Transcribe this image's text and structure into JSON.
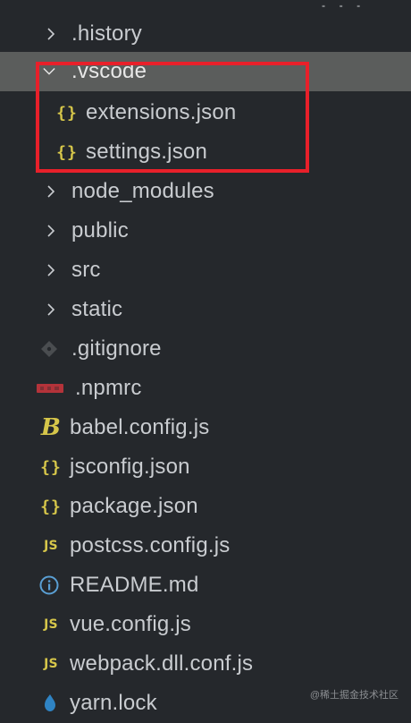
{
  "explorer": {
    "items": [
      {
        "label": ".history",
        "type": "folder",
        "expanded": false,
        "icon": "chevron-right-icon"
      },
      {
        "label": ".vscode",
        "type": "folder",
        "expanded": true,
        "selected": true,
        "icon": "chevron-down-icon"
      },
      {
        "label": "extensions.json",
        "type": "file",
        "icon": "json-braces-icon",
        "glyph": "{}"
      },
      {
        "label": "settings.json",
        "type": "file",
        "icon": "json-braces-icon",
        "glyph": "{}"
      },
      {
        "label": "node_modules",
        "type": "folder",
        "expanded": false,
        "icon": "chevron-right-icon"
      },
      {
        "label": "public",
        "type": "folder",
        "expanded": false,
        "icon": "chevron-right-icon"
      },
      {
        "label": "src",
        "type": "folder",
        "expanded": false,
        "icon": "chevron-right-icon"
      },
      {
        "label": "static",
        "type": "folder",
        "expanded": false,
        "icon": "chevron-right-icon"
      },
      {
        "label": ".gitignore",
        "type": "file",
        "icon": "git-diamond-icon"
      },
      {
        "label": ".npmrc",
        "type": "file",
        "icon": "npm-icon"
      },
      {
        "label": "babel.config.js",
        "type": "file",
        "icon": "babel-icon",
        "glyph": "B"
      },
      {
        "label": "jsconfig.json",
        "type": "file",
        "icon": "json-braces-icon",
        "glyph": "{}"
      },
      {
        "label": "package.json",
        "type": "file",
        "icon": "json-braces-icon",
        "glyph": "{}"
      },
      {
        "label": "postcss.config.js",
        "type": "file",
        "icon": "js-icon",
        "glyph": "JS"
      },
      {
        "label": "README.md",
        "type": "file",
        "icon": "info-circle-icon"
      },
      {
        "label": "vue.config.js",
        "type": "file",
        "icon": "js-icon",
        "glyph": "JS"
      },
      {
        "label": "webpack.dll.conf.js",
        "type": "file",
        "icon": "js-icon",
        "glyph": "JS"
      },
      {
        "label": "yarn.lock",
        "type": "file",
        "icon": "yarn-icon"
      }
    ]
  },
  "watermark": "@稀土掘金技术社区",
  "colors": {
    "background": "#25282c",
    "selected_row": "#5b5d5c",
    "highlight_border": "#e8202a",
    "json_icon": "#d6c64a",
    "git_icon": "#4a4d50",
    "npm_icon": "#b4333a",
    "info_icon": "#5a9fd4",
    "yarn_icon": "#2f84c4"
  }
}
